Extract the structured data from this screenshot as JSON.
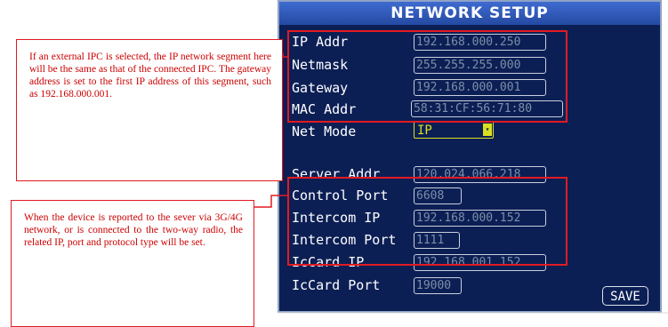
{
  "screen": {
    "title": "NETWORK SETUP",
    "fields": [
      {
        "label": "IP Addr",
        "value": "192.168.000.250"
      },
      {
        "label": "Netmask",
        "value": "255.255.255.000"
      },
      {
        "label": "Gateway",
        "value": "192.168.000.001"
      },
      {
        "label": "MAC Addr",
        "value": "58:31:CF:56:71:80"
      },
      {
        "label": "Net Mode",
        "value": "IP"
      },
      {
        "label": "Server Addr",
        "value": "120.024.066.218"
      },
      {
        "label": "Control Port",
        "value": "6608"
      },
      {
        "label": "Intercom IP",
        "value": "192.168.000.152"
      },
      {
        "label": "Intercom Port",
        "value": "1111"
      },
      {
        "label": "IcCard IP",
        "value": "192.168.001.152"
      },
      {
        "label": "IcCard Port",
        "value": "19000"
      }
    ],
    "save_label": "SAVE"
  },
  "annotations": {
    "ipc_note": "If an external IPC is selected, the IP network segment here will be the same as that of the connected IPC. The gateway address is set to the first IP address of this segment, such as 192.168.000.001.",
    "server_note": "When the device is reported to the sever via 3G/4G network, or is connected to the two-way radio, the related IP, port and protocol type will be set."
  },
  "colors": {
    "screen_bg": "#0c1f55",
    "title_bar": "#2f58b8",
    "annotation_red": "#e11a22",
    "select_yellow": "#d8e020",
    "field_text": "#7d8ea8"
  }
}
